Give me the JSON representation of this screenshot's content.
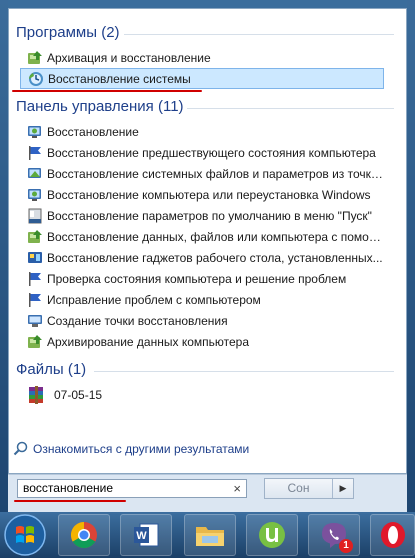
{
  "sections": {
    "programs": {
      "title": "Программы (2)",
      "items": [
        {
          "label": "Архивация и восстановление",
          "icon": "backup-icon"
        },
        {
          "label": "Восстановление системы",
          "icon": "system-restore-icon",
          "selected": true
        }
      ]
    },
    "control_panel": {
      "title": "Панель управления (11)",
      "items": [
        {
          "label": "Восстановление",
          "icon": "recovery-icon"
        },
        {
          "label": "Восстановление предшествующего состояния компьютера",
          "icon": "action-center-flag-icon"
        },
        {
          "label": "Восстановление системных файлов и параметров из точки ...",
          "icon": "system-restore-icon"
        },
        {
          "label": "Восстановление компьютера или переустановка Windows",
          "icon": "recovery-icon"
        },
        {
          "label": "Восстановление параметров по умолчанию в меню \"Пуск\"",
          "icon": "taskbar-icon"
        },
        {
          "label": "Восстановление данных, файлов или компьютера с помощ...",
          "icon": "backup-icon"
        },
        {
          "label": "Восстановление гаджетов рабочего стола, установленных...",
          "icon": "gadgets-icon"
        },
        {
          "label": "Проверка состояния компьютера и решение проблем",
          "icon": "action-center-flag-icon"
        },
        {
          "label": "Исправление проблем с компьютером",
          "icon": "action-center-flag-icon"
        },
        {
          "label": "Создание точки восстановления",
          "icon": "computer-icon"
        },
        {
          "label": "Архивирование данных компьютера",
          "icon": "backup-icon"
        }
      ]
    },
    "files": {
      "title": "Файлы (1)",
      "items": [
        {
          "label": "07-05-15",
          "icon": "winrar-archive-icon"
        }
      ]
    }
  },
  "more_results": "Ознакомиться с другими результатами",
  "search": {
    "value": "восстановление",
    "clear": "×"
  },
  "shutdown": {
    "label": "Сон",
    "arrow": "▶"
  },
  "taskbar": {
    "items": [
      {
        "name": "start-orb"
      },
      {
        "name": "chrome-icon"
      },
      {
        "name": "word-icon",
        "text": "W"
      },
      {
        "name": "explorer-icon"
      },
      {
        "name": "utorrent-icon"
      },
      {
        "name": "viber-icon",
        "badge": "1"
      },
      {
        "name": "opera-icon"
      }
    ]
  },
  "colors": {
    "accent": "#1e3f8a",
    "selection": "#cce8ff",
    "underline": "#d00000"
  }
}
